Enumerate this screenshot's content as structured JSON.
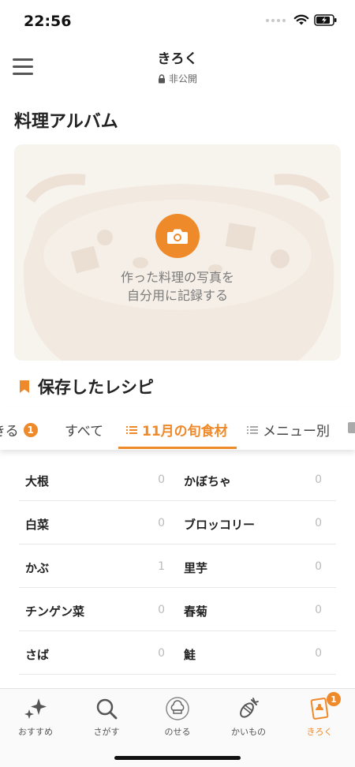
{
  "status": {
    "time": "22:56"
  },
  "nav": {
    "title": "きろく",
    "privacy": "非公開"
  },
  "album": {
    "title": "料理アルバム",
    "prompt_line1": "作った料理の写真を",
    "prompt_line2": "自分用に記録する"
  },
  "saved": {
    "title": "保存したレシピ"
  },
  "tabs": [
    {
      "label": "きる",
      "badge": "1"
    },
    {
      "label": "すべて"
    },
    {
      "label": "11月の旬食材",
      "active": true
    },
    {
      "label": "メニュー別"
    }
  ],
  "ingredients": [
    {
      "name": "大根",
      "count": "0"
    },
    {
      "name": "かぼちゃ",
      "count": "0"
    },
    {
      "name": "白菜",
      "count": "0"
    },
    {
      "name": "ブロッコリー",
      "count": "0"
    },
    {
      "name": "かぶ",
      "count": "1"
    },
    {
      "name": "里芋",
      "count": "0"
    },
    {
      "name": "チンゲン菜",
      "count": "0"
    },
    {
      "name": "春菊",
      "count": "0"
    },
    {
      "name": "さば",
      "count": "0"
    },
    {
      "name": "鮭",
      "count": "0"
    }
  ],
  "bottom_nav": [
    {
      "label": "おすすめ",
      "icon": "sparkle-icon"
    },
    {
      "label": "さがす",
      "icon": "search-icon"
    },
    {
      "label": "のせる",
      "icon": "chef-hat-icon"
    },
    {
      "label": "かいもの",
      "icon": "shopping-icon"
    },
    {
      "label": "きろく",
      "icon": "record-icon",
      "active": true,
      "badge": "1"
    }
  ],
  "colors": {
    "accent": "#ef8a2b",
    "text": "#222222",
    "muted": "#bbbbbb"
  }
}
